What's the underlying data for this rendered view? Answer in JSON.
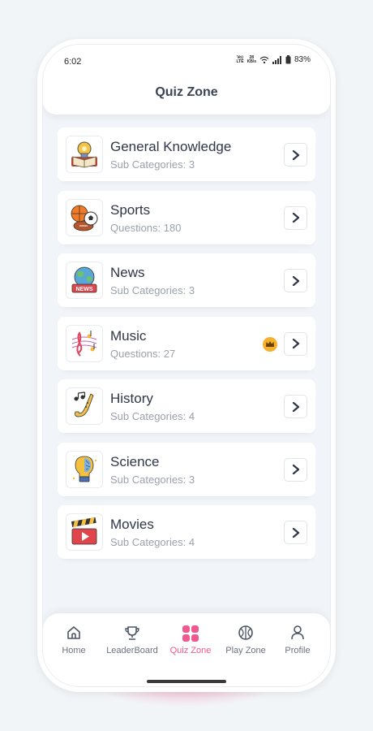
{
  "status": {
    "time": "6:02",
    "lte_top": "Vo)",
    "lte_bottom": "LTE",
    "speed_top": "28",
    "speed_bottom": "KB/s",
    "battery": "83%"
  },
  "header": {
    "title": "Quiz Zone"
  },
  "categories": [
    {
      "title": "General Knowledge",
      "subtitle": "Sub Categories: 3",
      "icon": "lightbulb-book-icon"
    },
    {
      "title": "Sports",
      "subtitle": "Questions: 180",
      "icon": "balls-icon"
    },
    {
      "title": "News",
      "subtitle": "Sub Categories: 3",
      "icon": "globe-news-icon",
      "badge": "NEWS"
    },
    {
      "title": "Music",
      "subtitle": "Questions: 27",
      "icon": "music-notes-icon",
      "premium": true
    },
    {
      "title": "History",
      "subtitle": "Sub Categories: 4",
      "icon": "saxophone-icon"
    },
    {
      "title": "Science",
      "subtitle": "Sub Categories: 3",
      "icon": "lightbulb-brain-icon"
    },
    {
      "title": "Movies",
      "subtitle": "Sub Categories: 4",
      "icon": "clapperboard-icon"
    }
  ],
  "nav": [
    {
      "label": "Home",
      "icon": "home-icon",
      "active": false
    },
    {
      "label": "LeaderBoard",
      "icon": "trophy-icon",
      "active": false
    },
    {
      "label": "Quiz Zone",
      "icon": "grid-icon",
      "active": true
    },
    {
      "label": "Play Zone",
      "icon": "ball-icon",
      "active": false
    },
    {
      "label": "Profile",
      "icon": "user-icon",
      "active": false
    }
  ],
  "colors": {
    "accent": "#ee5a8f",
    "title": "#2f3648",
    "subtitle": "#9aa1ad",
    "background": "#f1f4f8"
  }
}
